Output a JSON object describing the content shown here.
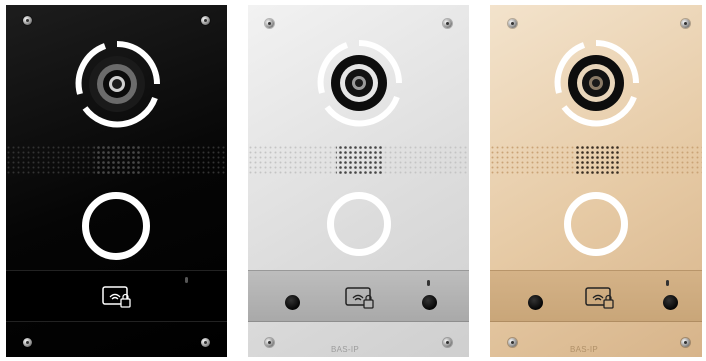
{
  "panels": [
    {
      "finish": "black",
      "brand": ""
    },
    {
      "finish": "silver",
      "brand": "BAS-IP"
    },
    {
      "finish": "gold",
      "brand": "BAS-IP"
    }
  ],
  "colors": {
    "black_panel": "#0b0b0b",
    "silver_panel": "#dcdcdc",
    "gold_panel": "#e6caa5",
    "ring": "#ffffff"
  },
  "icons": [
    "screw-icon",
    "camera-lens-icon",
    "speaker-grille-icon",
    "call-button-ring-icon",
    "card-reader-icon",
    "microphone-hole-icon",
    "led-indicator-icon"
  ]
}
